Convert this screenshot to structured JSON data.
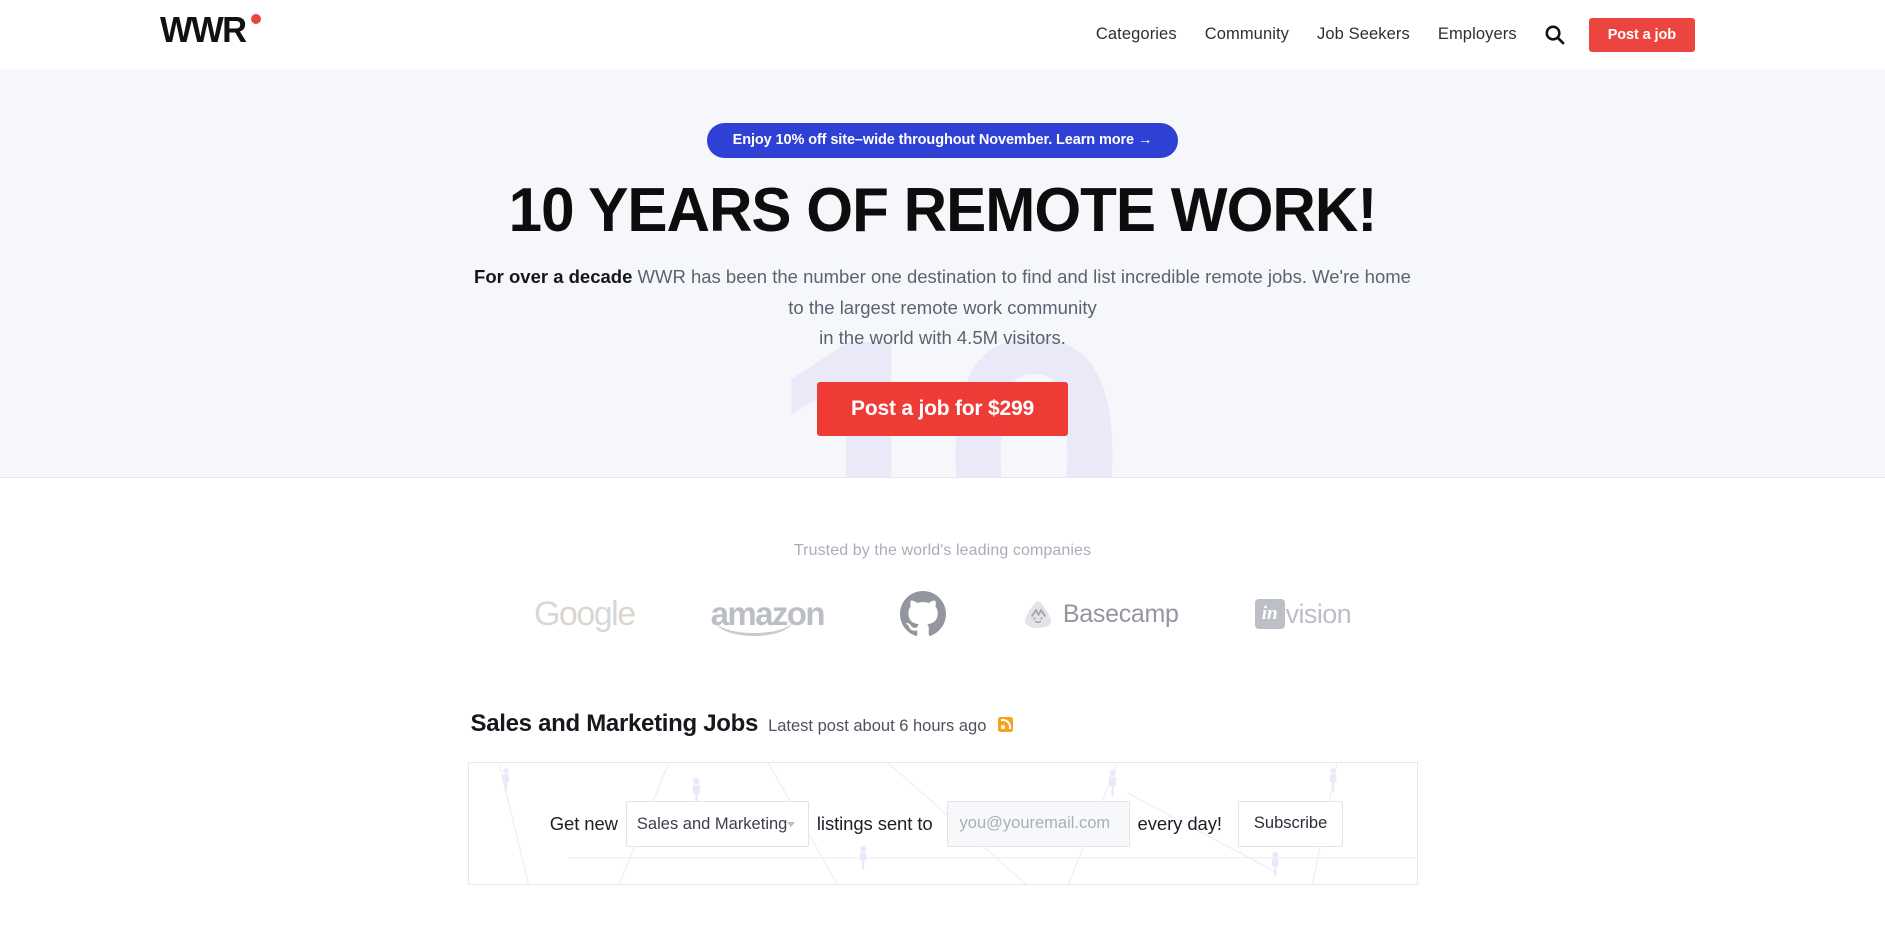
{
  "header": {
    "logo_text": "WWR",
    "nav": [
      {
        "label": "Categories"
      },
      {
        "label": "Community"
      },
      {
        "label": "Job Seekers"
      },
      {
        "label": "Employers"
      }
    ],
    "search_icon": "search-icon",
    "post_job_label": "Post a job"
  },
  "hero": {
    "promo_banner": "Enjoy 10% off site–wide throughout November. Learn more →",
    "title": "10 YEARS OF REMOTE WORK!",
    "sub_bold": "For over a decade",
    "sub_rest": " WWR has been the number one destination to find and list incredible remote jobs. We're home to the largest remote work community",
    "sub_line3": "in the world with 4.5M visitors.",
    "cta_label": "Post a job for $299",
    "watermark": "10",
    "bg_color": "#f6f7fb",
    "accent_color": "#ee3b36",
    "promo_color": "#2f41d4"
  },
  "trusted": {
    "label": "Trusted by the world's leading companies",
    "companies": [
      {
        "name": "Google",
        "letters": [
          "G",
          "o",
          "o",
          "g",
          "l",
          "e"
        ]
      },
      {
        "name": "amazon"
      },
      {
        "name": "GitHub"
      },
      {
        "name": "Basecamp"
      },
      {
        "name": "InVision",
        "badge": "in",
        "rest": "vision"
      }
    ]
  },
  "jobs": {
    "title": "Sales and Marketing Jobs",
    "meta": "Latest post about 6 hours ago",
    "rss_icon": "rss-icon"
  },
  "subscribe": {
    "prefix": "Get new",
    "category_selected": "Sales and Marketing",
    "category_options": [
      "Sales and Marketing"
    ],
    "middle": "listings sent to",
    "email_placeholder": "you@youremail.com",
    "email_value": "",
    "suffix": "every day!",
    "button_label": "Subscribe"
  }
}
